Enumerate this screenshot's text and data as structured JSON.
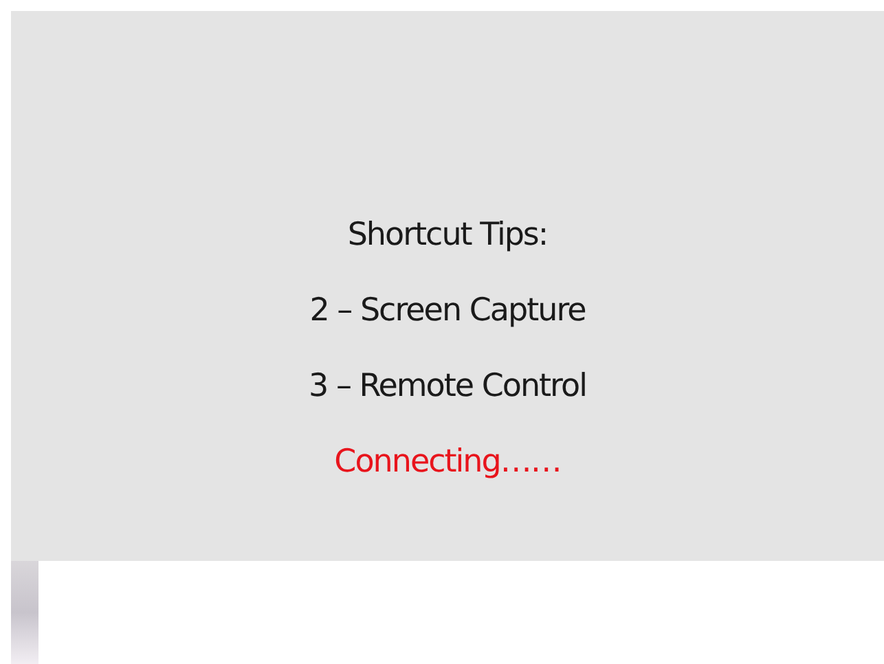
{
  "tips": {
    "title": "Shortcut Tips:",
    "items": [
      "2 – Screen Capture",
      "3 – Remote Control"
    ]
  },
  "status": {
    "kind": "connecting",
    "text": "Connecting……"
  }
}
